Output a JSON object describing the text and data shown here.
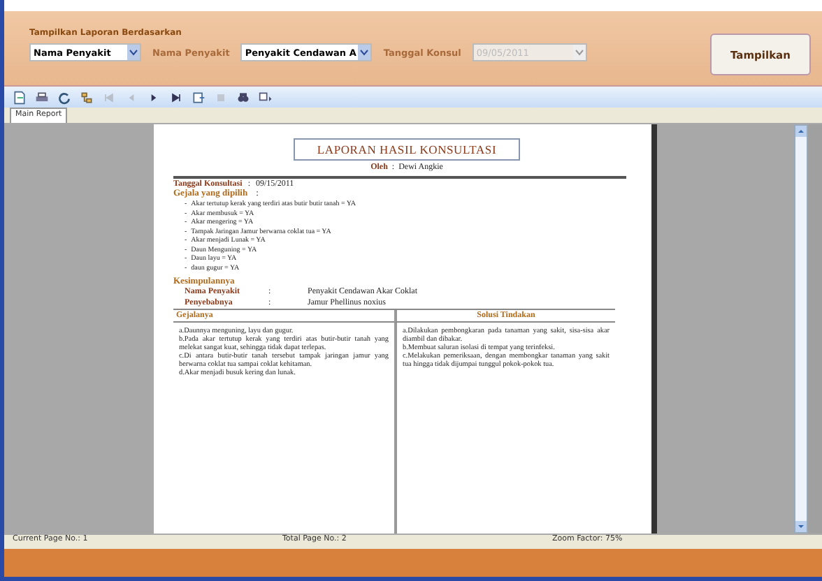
{
  "filter_panel": {
    "title": "Tampilkan Laporan Berdasarkan",
    "criteria": {
      "value": "Nama Penyakit"
    },
    "disease_label": "Nama Penyakit",
    "disease": {
      "value": "Penyakit Cendawan A"
    },
    "date_label": "Tanggal Konsul",
    "date": {
      "value": "09/05/2011",
      "disabled": true
    },
    "show_button": "Tampilkan"
  },
  "tabs": [
    {
      "label": "Main Report",
      "selected": true
    }
  ],
  "report": {
    "title": "LAPORAN HASIL KONSULTASI",
    "author_label": "Oleh",
    "author": "Dewi Angkie",
    "date_label": "Tanggal Konsultasi",
    "date": "09/15/2011",
    "separator": ":",
    "bullet": "-",
    "symptoms_heading": "Gejala yang dipilih",
    "symptoms": [
      "Akar tertutup kerak yang terdiri atas butir butir tanah = YA",
      "Akar membusuk = YA",
      "Akar mengering = YA",
      "Tampak Jaringan Jamur berwarna coklat tua = YA",
      "Akar menjadi Lunak = YA",
      "Daun Menguning = YA",
      "Daun layu = YA",
      "daun gugur = YA"
    ],
    "conclusion_heading": "Kesimpulannya",
    "facts": [
      {
        "label": "Nama Penyakit",
        "value": "Penyakit Cendawan Akar Coklat"
      },
      {
        "label": "Penyebabnya",
        "value": "Jamur Phellinus noxius"
      }
    ],
    "columns": [
      "Gejalanya",
      "Solusi Tindakan"
    ],
    "symptoms_text": [
      "a.Daunnya menguning, layu dan gugur.",
      "b.Pada akar tertutup kerak yang terdiri atas butir-butir tanah yang melekat sangat kuat, sehingga tidak dapat terlepas.",
      "c.Di antara butir-butir tanah tersebut tampak jaringan jamur yang berwarna coklat tua sampai coklat kehitaman.",
      "d.Akar menjadi busuk kering dan lunak."
    ],
    "solutions_text": [
      "a.Dilakukan pembongkaran pada tanaman yang sakit, sisa-sisa akar diambil dan dibakar.",
      "b.Membuat saluran isolasi di tempat yang terinfeksi.",
      "c.Melakukan pemeriksaan, dengan membongkar tanaman yang sakit tua hingga tidak dijumpai tunggul pokok-pokok tua."
    ]
  },
  "status_bar": [
    "Current Page No.: 1",
    "Total Page No.: 2",
    "Zoom Factor: 75%"
  ]
}
